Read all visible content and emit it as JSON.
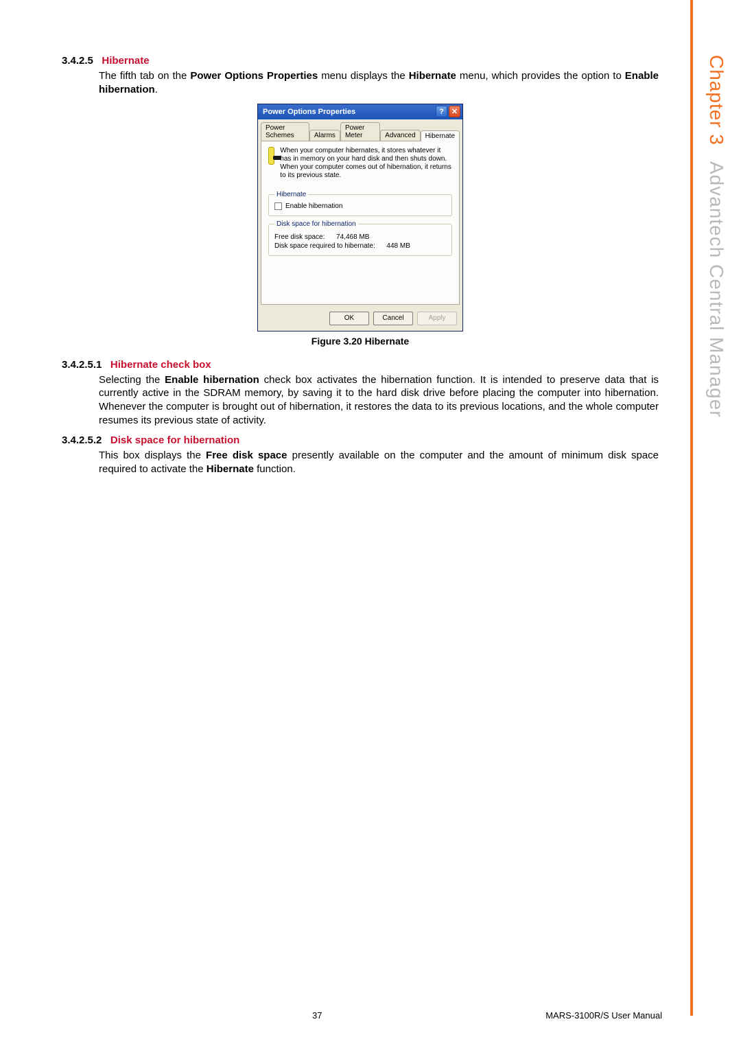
{
  "side": {
    "chapter": "Chapter 3",
    "title": "Advantech Central Manager"
  },
  "sec3425": {
    "num": "3.4.2.5",
    "title": "Hibernate",
    "para_a": "The fifth tab on the ",
    "para_b": "Power Options Properties",
    "para_c": " menu displays the ",
    "para_d": "Hibernate",
    "para_e": " menu, which provides the option to ",
    "para_f": "Enable hibernation",
    "para_g": "."
  },
  "dialog": {
    "title": "Power Options Properties",
    "help_glyph": "?",
    "close_glyph": "✕",
    "tabs": [
      "Power Schemes",
      "Alarms",
      "Power Meter",
      "Advanced",
      "Hibernate"
    ],
    "info": "When your computer hibernates, it stores whatever it has in memory on your hard disk and then shuts down. When your computer comes out of hibernation, it returns to its previous state.",
    "grp_hibernate": {
      "legend": "Hibernate",
      "chk_label": "Enable hibernation"
    },
    "grp_disk": {
      "legend": "Disk space for hibernation",
      "free_label": "Free disk space:",
      "free_value": "74,468 MB",
      "req_label": "Disk space required to hibernate:",
      "req_value": "448 MB"
    },
    "buttons": {
      "ok": "OK",
      "cancel": "Cancel",
      "apply": "Apply"
    }
  },
  "fig_caption": "Figure 3.20 Hibernate",
  "sec34251": {
    "num": "3.4.2.5.1",
    "title": "Hibernate check box",
    "p_a": "Selecting the ",
    "p_b": "Enable hibernation",
    "p_c": " check box activates the hibernation function. It is intended to preserve data that is currently active in the SDRAM memory, by saving it to the hard disk drive before placing the computer into hibernation. Whenever the computer is brought out of hibernation, it restores the data to its previous locations, and the whole computer resumes its previous state of activity."
  },
  "sec34252": {
    "num": "3.4.2.5.2",
    "title": "Disk space for hibernation",
    "p_a": "This box displays the ",
    "p_b": "Free disk space",
    "p_c": " presently available on the computer and the amount of minimum disk space required to activate the ",
    "p_d": "Hibernate",
    "p_e": " function."
  },
  "footer": {
    "page": "37",
    "manual": "MARS-3100R/S User Manual"
  }
}
